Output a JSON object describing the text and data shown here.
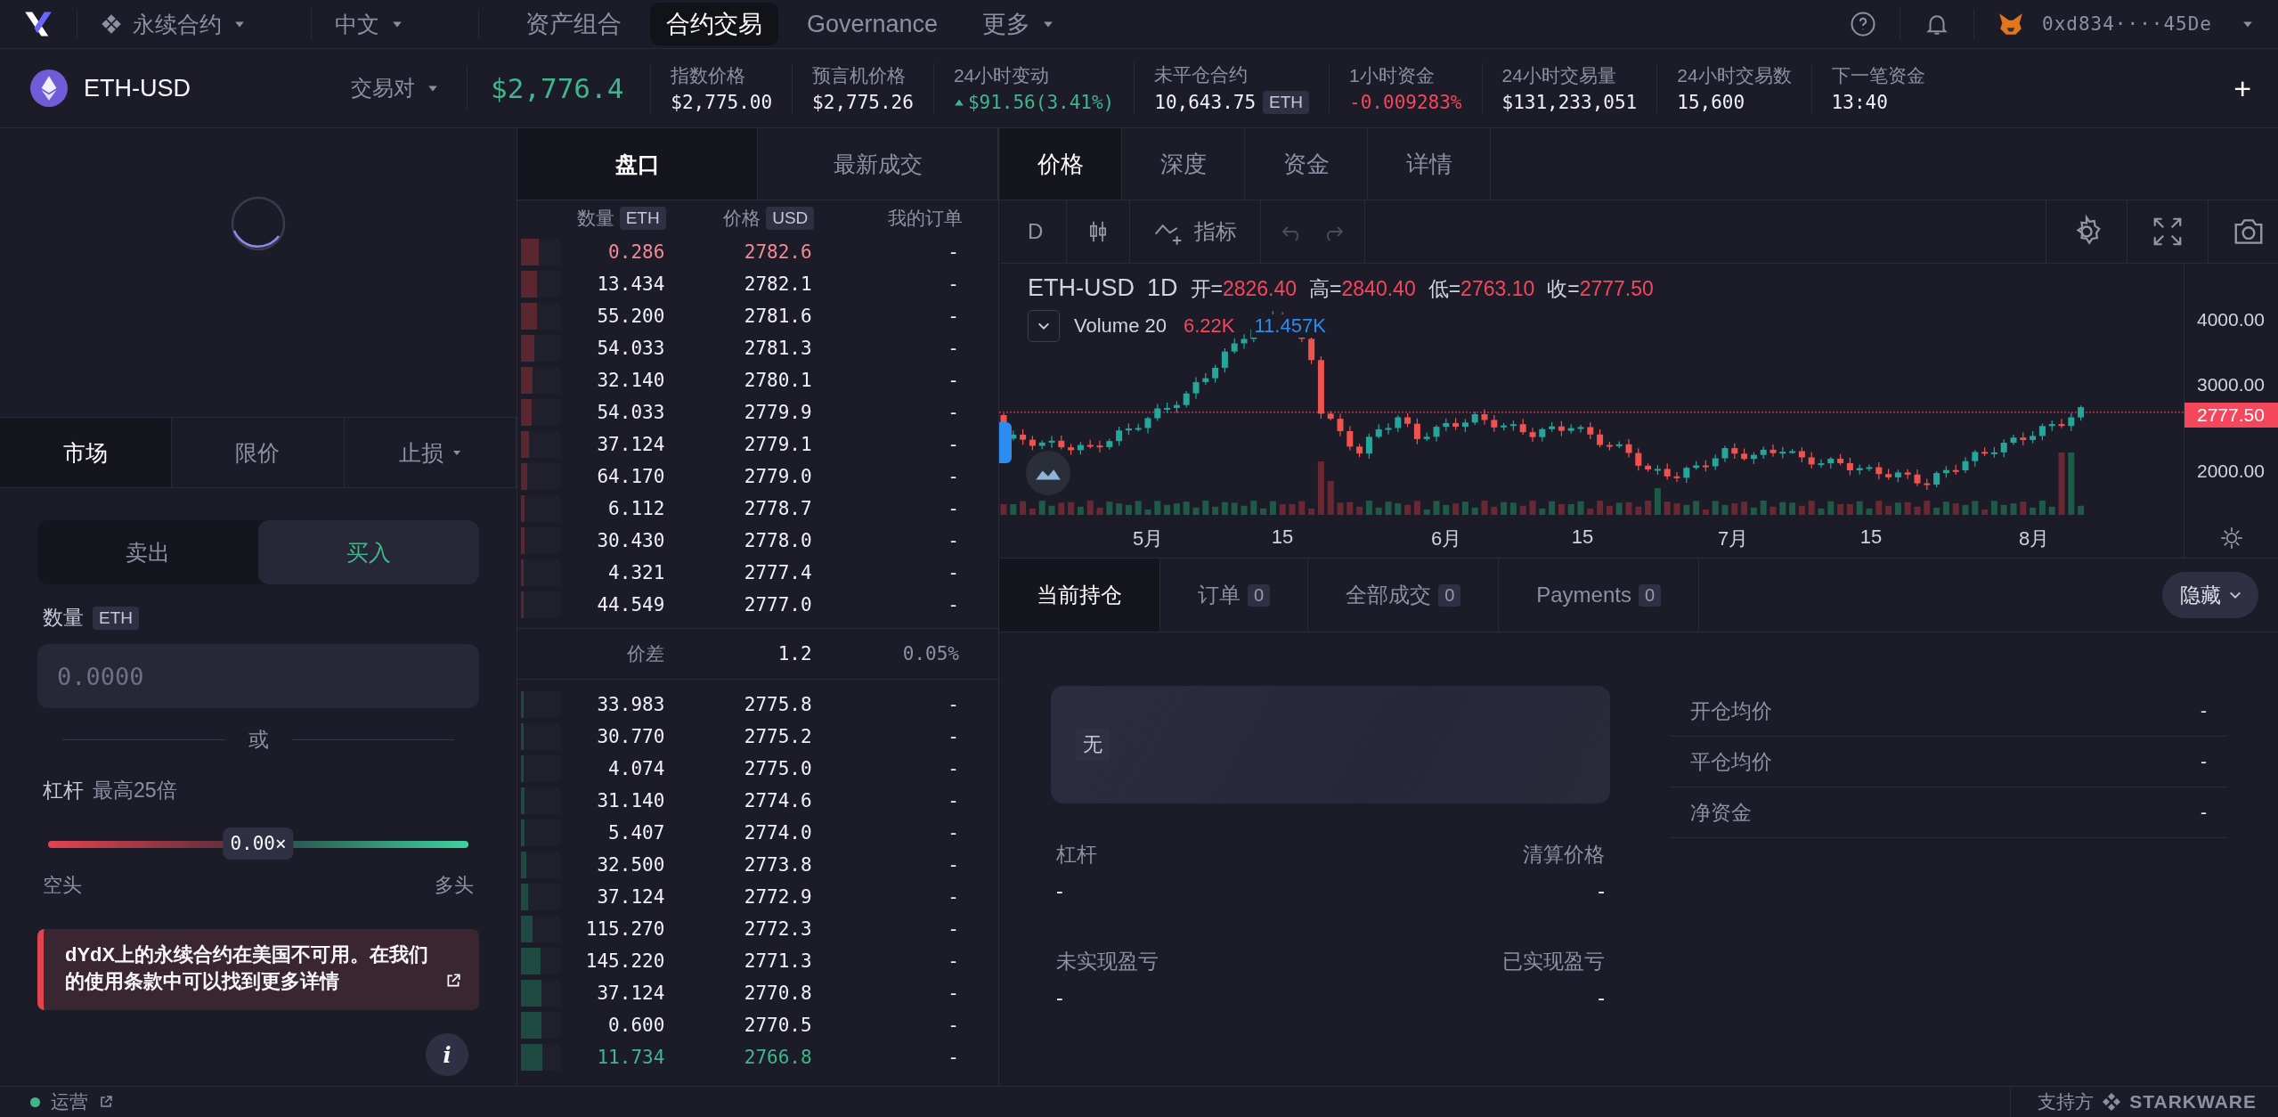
{
  "nav": {
    "market_menu": "永续合约",
    "language": "中文",
    "links": [
      {
        "label": "资产组合",
        "selected": false,
        "dropdown": false
      },
      {
        "label": "合约交易",
        "selected": true,
        "dropdown": false
      },
      {
        "label": "Governance",
        "selected": false,
        "dropdown": false
      },
      {
        "label": "更多",
        "selected": false,
        "dropdown": true
      }
    ],
    "wallet": "0xd834····45De"
  },
  "market": {
    "symbol": "ETH-USD",
    "pair_menu": "交易对",
    "price": "$2,776.4",
    "stats": [
      {
        "label": "指数价格",
        "value": "$2,775.00",
        "rising": false,
        "falling": false
      },
      {
        "label": "预言机价格",
        "value": "$2,775.26",
        "rising": false,
        "falling": false
      },
      {
        "label": "24小时变动",
        "value": "$91.56",
        "suffix": "(3.41%)",
        "rising": true,
        "falling": false
      },
      {
        "label": "未平仓合约",
        "value": "10,643.75",
        "badge": "ETH",
        "rising": false,
        "falling": false
      },
      {
        "label": "1小时资金",
        "value": "-0.009283%",
        "rising": false,
        "falling": true
      },
      {
        "label": "24小时交易量",
        "value": "$131,233,051",
        "rising": false,
        "falling": false
      },
      {
        "label": "24小时交易数",
        "value": "15,600",
        "rising": false,
        "falling": false
      },
      {
        "label": "下一笔资金",
        "value": "13:40",
        "rising": false,
        "falling": false
      }
    ],
    "add_button": "+"
  },
  "order_form": {
    "types": [
      {
        "label": "市场",
        "selected": true,
        "dropdown": false
      },
      {
        "label": "限价",
        "selected": false,
        "dropdown": false
      },
      {
        "label": "止损",
        "selected": false,
        "dropdown": true
      }
    ],
    "sides": [
      {
        "label": "卖出",
        "kind": "sell",
        "selected": false
      },
      {
        "label": "买入",
        "kind": "buy",
        "selected": true
      }
    ],
    "amount": {
      "label": "数量",
      "badge": "ETH",
      "placeholder": "0.0000"
    },
    "or": "或",
    "leverage": {
      "label": "杠杆",
      "hint": "最高25倍",
      "level": 0.5,
      "reading": "0.00×",
      "left": "空头",
      "right": "多头"
    },
    "warning": "dYdX上的永续合约在美国不可用。在我们的使用条款中可以找到更多详情",
    "info_button": "i"
  },
  "status": {
    "label": "运营",
    "color": "#3fb68b"
  },
  "orderbook": {
    "tabs": [
      {
        "label": "盘口",
        "selected": true
      },
      {
        "label": "最新成交",
        "selected": false
      }
    ],
    "columns": [
      {
        "label": "数量",
        "badge": "ETH"
      },
      {
        "label": "价格",
        "badge": "USD"
      },
      {
        "label": "我的订单"
      }
    ],
    "asks": [
      {
        "size": "0.286",
        "price": "2782.6",
        "mine": "-",
        "level": 0.45,
        "highlighted": true
      },
      {
        "size": "13.434",
        "price": "2782.1",
        "mine": "-",
        "level": 0.42,
        "highlighted": false
      },
      {
        "size": "55.200",
        "price": "2781.6",
        "mine": "-",
        "level": 0.4,
        "highlighted": false
      },
      {
        "size": "54.033",
        "price": "2781.3",
        "mine": "-",
        "level": 0.34,
        "highlighted": false
      },
      {
        "size": "32.140",
        "price": "2780.1",
        "mine": "-",
        "level": 0.3,
        "highlighted": false
      },
      {
        "size": "54.033",
        "price": "2779.9",
        "mine": "-",
        "level": 0.27,
        "highlighted": false
      },
      {
        "size": "37.124",
        "price": "2779.1",
        "mine": "-",
        "level": 0.2,
        "highlighted": false
      },
      {
        "size": "64.170",
        "price": "2779.0",
        "mine": "-",
        "level": 0.16,
        "highlighted": false
      },
      {
        "size": "6.112",
        "price": "2778.7",
        "mine": "-",
        "level": 0.1,
        "highlighted": false
      },
      {
        "size": "30.430",
        "price": "2778.0",
        "mine": "-",
        "level": 0.1,
        "highlighted": false
      },
      {
        "size": "4.321",
        "price": "2777.4",
        "mine": "-",
        "level": 0.06,
        "highlighted": false
      },
      {
        "size": "44.549",
        "price": "2777.0",
        "mine": "-",
        "level": 0.06,
        "highlighted": false
      }
    ],
    "spread": {
      "label": "价差",
      "value": "1.2",
      "percent": "0.05%"
    },
    "bids": [
      {
        "size": "33.983",
        "price": "2775.8",
        "mine": "-",
        "level": 0.06,
        "highlighted": false
      },
      {
        "size": "30.770",
        "price": "2775.2",
        "mine": "-",
        "level": 0.06,
        "highlighted": false
      },
      {
        "size": "4.074",
        "price": "2775.0",
        "mine": "-",
        "level": 0.07,
        "highlighted": false
      },
      {
        "size": "31.140",
        "price": "2774.6",
        "mine": "-",
        "level": 0.1,
        "highlighted": false
      },
      {
        "size": "5.407",
        "price": "2774.0",
        "mine": "-",
        "level": 0.1,
        "highlighted": false
      },
      {
        "size": "32.500",
        "price": "2773.8",
        "mine": "-",
        "level": 0.14,
        "highlighted": false
      },
      {
        "size": "37.124",
        "price": "2772.9",
        "mine": "-",
        "level": 0.18,
        "highlighted": false
      },
      {
        "size": "115.270",
        "price": "2772.3",
        "mine": "-",
        "level": 0.3,
        "highlighted": false
      },
      {
        "size": "145.220",
        "price": "2771.3",
        "mine": "-",
        "level": 0.5,
        "highlighted": false
      },
      {
        "size": "37.124",
        "price": "2770.8",
        "mine": "-",
        "level": 0.52,
        "highlighted": false
      },
      {
        "size": "0.600",
        "price": "2770.5",
        "mine": "-",
        "level": 0.52,
        "highlighted": false
      },
      {
        "size": "11.734",
        "price": "2766.8",
        "mine": "-",
        "level": 0.55,
        "highlighted": true
      }
    ]
  },
  "chart": {
    "tabs": [
      {
        "label": "价格",
        "selected": true
      },
      {
        "label": "深度",
        "selected": false
      },
      {
        "label": "资金",
        "selected": false
      },
      {
        "label": "详情",
        "selected": false
      }
    ],
    "interval_button": "D",
    "indicators_button": "指标",
    "legend": {
      "symbol": "ETH-USD",
      "interval": "1D",
      "ohlc": [
        {
          "label": "开=",
          "value": "2826.40"
        },
        {
          "label": "高=",
          "value": "2840.40"
        },
        {
          "label": "低=",
          "value": "2763.10"
        },
        {
          "label": "收=",
          "value": "2777.50"
        }
      ],
      "volume_label": "Volume 20",
      "volume_values": [
        {
          "value": "6.22K",
          "color": "#f5475b"
        },
        {
          "value": "11.457K",
          "color": "#2c8cf0"
        }
      ]
    },
    "y_axis": [
      "4000.00",
      "3000.00",
      "2000.00"
    ],
    "last_price": "2777.50",
    "x_axis": [
      "5月",
      "15",
      "6月",
      "15",
      "7月",
      "15",
      "8月"
    ]
  },
  "positions": {
    "tabs": [
      {
        "label": "当前持仓",
        "selected": true
      },
      {
        "label": "订单",
        "count": "0",
        "selected": false
      },
      {
        "label": "全部成交",
        "count": "0",
        "selected": false
      },
      {
        "label": "Payments",
        "count": "0",
        "selected": false
      }
    ],
    "hide_button": "隐藏",
    "card_badge": "无",
    "fields": [
      {
        "label": "杠杆",
        "value": "-"
      },
      {
        "label": "清算价格",
        "value": "-"
      },
      {
        "label": "未实现盈亏",
        "value": "-"
      },
      {
        "label": "已实现盈亏",
        "value": "-"
      }
    ],
    "details": [
      {
        "label": "开仓均价",
        "value": "-"
      },
      {
        "label": "平仓均价",
        "value": "-"
      },
      {
        "label": "净资金",
        "value": "-"
      }
    ]
  },
  "footer": {
    "powered_by": "支持方",
    "brand": "STARKWARE"
  }
}
